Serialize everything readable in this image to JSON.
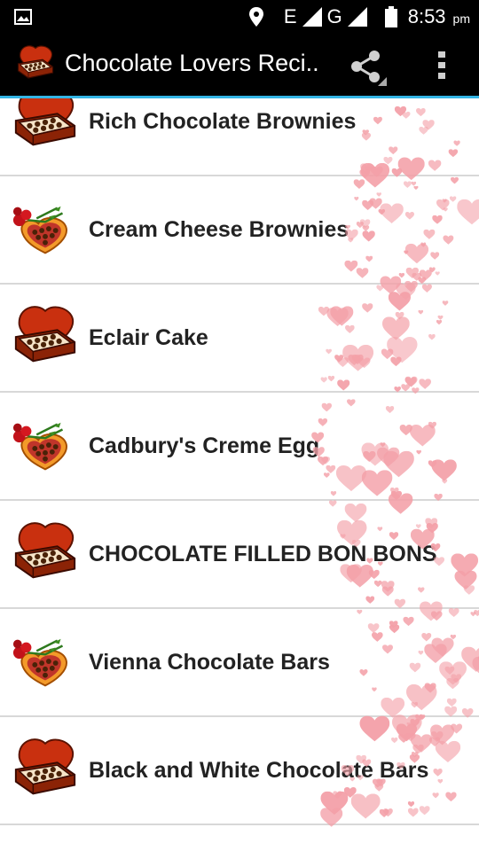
{
  "status_bar": {
    "network_e": "E",
    "network_g": "G",
    "time": "8:53",
    "ampm": "pm"
  },
  "app_bar": {
    "title": "Chocolate Lovers Reci..",
    "icons": [
      "chocolate-box-icon",
      "share-icon",
      "more-options-icon"
    ]
  },
  "recipes": [
    {
      "label": "Rich Chocolate Brownies",
      "icon": "chocolate-heart-box-icon"
    },
    {
      "label": "Cream Cheese Brownies",
      "icon": "chocolate-roses-box-icon"
    },
    {
      "label": "Eclair Cake",
      "icon": "chocolate-heart-box-icon"
    },
    {
      "label": "Cadbury's Creme Egg",
      "icon": "chocolate-roses-box-icon"
    },
    {
      "label": "CHOCOLATE FILLED BON BONS",
      "icon": "chocolate-heart-box-icon"
    },
    {
      "label": "Vienna Chocolate Bars",
      "icon": "chocolate-roses-box-icon"
    },
    {
      "label": "Black and White Chocolate Bars",
      "icon": "chocolate-heart-box-icon"
    }
  ],
  "colors": {
    "accent": "#33b5e5",
    "divider": "#d8d8d8",
    "heart": "#f4a0a8"
  }
}
